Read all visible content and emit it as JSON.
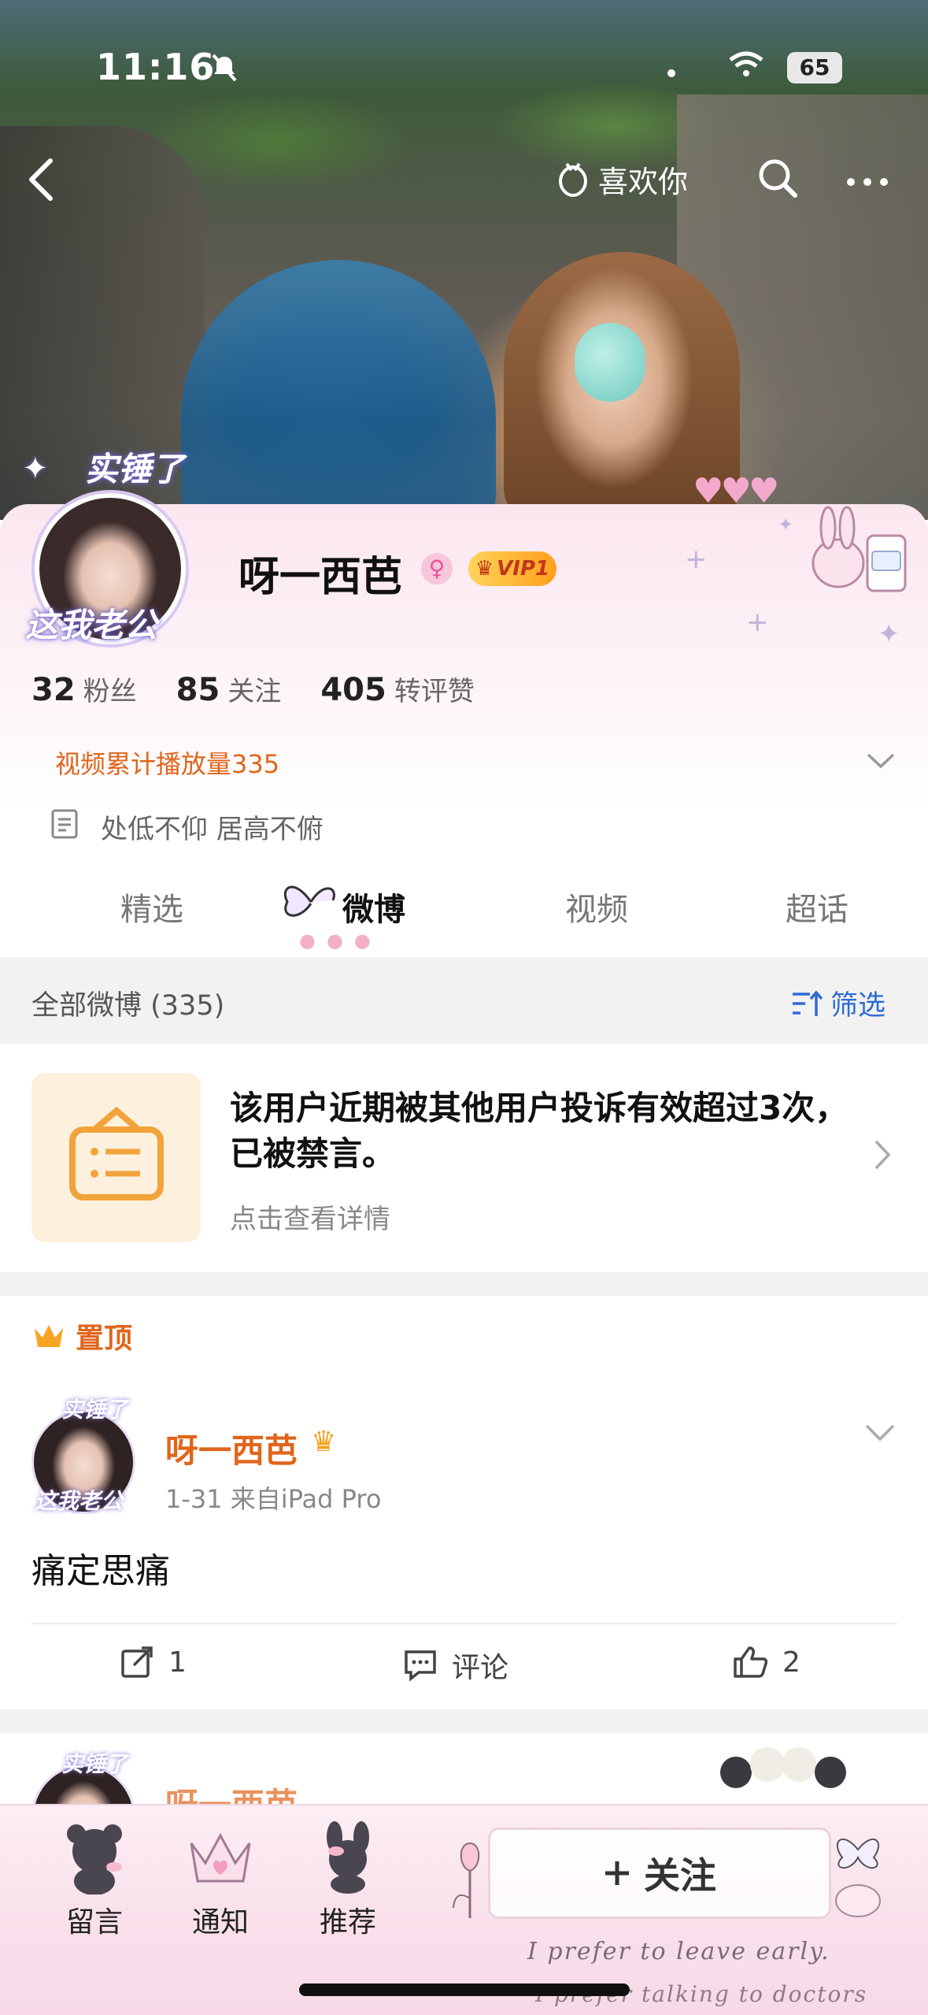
{
  "status_bar": {
    "time": "11:16",
    "battery": "65"
  },
  "nav": {
    "likes_you": "喜欢你"
  },
  "profile": {
    "avatar_badge_top": "实锤了",
    "avatar_badge_bottom": "这我老公",
    "username": "呀一西芭",
    "vip_label": "VIP1",
    "stats": [
      {
        "num": "32",
        "label": "粉丝"
      },
      {
        "num": "85",
        "label": "关注"
      },
      {
        "num": "405",
        "label": "转评赞"
      }
    ],
    "play_count": "视频累计播放量335",
    "bio": "处低不仰 居高不俯"
  },
  "tabs": [
    {
      "label": "精选"
    },
    {
      "label": "微博"
    },
    {
      "label": "视频"
    },
    {
      "label": "超话"
    }
  ],
  "section": {
    "all_weibo": "全部微博 (335)",
    "filter": "筛选"
  },
  "notice": {
    "title": "该用户近期被其他用户投诉有效超过3次，已被禁言。",
    "link": "点击查看详情"
  },
  "post": {
    "pinned": "置顶",
    "avatar_top": "实锤了",
    "avatar_bottom": "这我老公",
    "username": "呀一西芭",
    "meta": "1-31  来自iPad Pro",
    "body": "痛定思痛",
    "reposts": "1",
    "comment_label": "评论",
    "likes": "2"
  },
  "post2": {
    "avatar_top": "实锤了",
    "username": "呀一西芭"
  },
  "bottom_bar": {
    "items": [
      {
        "label": "留言"
      },
      {
        "label": "通知"
      },
      {
        "label": "推荐"
      }
    ],
    "follow_label": "关注",
    "script1": "I prefer to leave early.",
    "script2": "I prefer talking to doctors"
  },
  "colors": {
    "accent_orange": "#e0651b",
    "link_blue": "#2e6bd6",
    "vip_gold": "#ffb62e"
  }
}
